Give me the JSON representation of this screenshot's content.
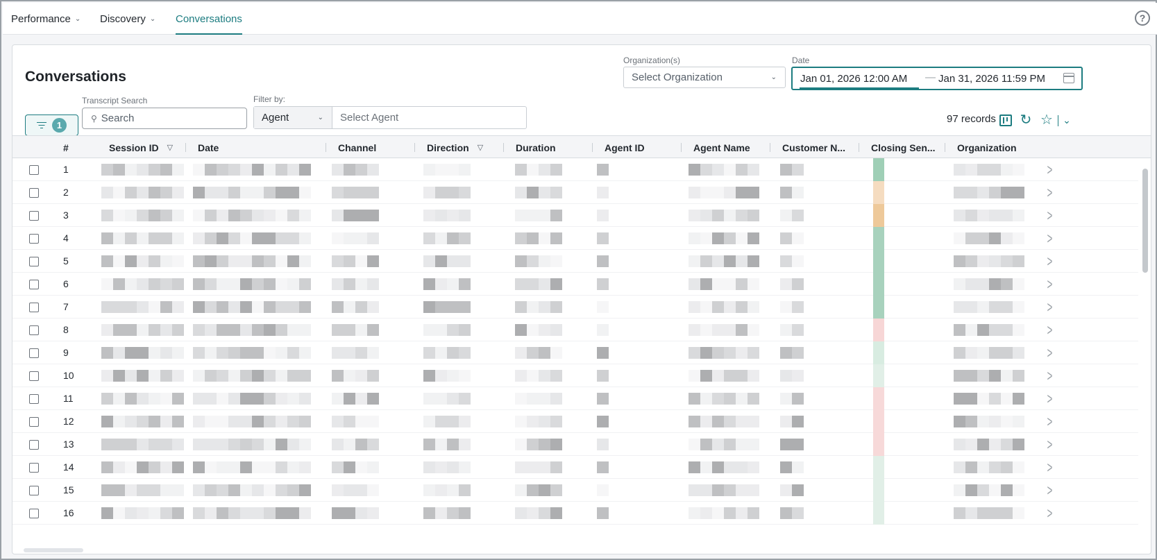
{
  "nav": {
    "items": [
      {
        "label": "Performance",
        "has_menu": true,
        "active": false
      },
      {
        "label": "Discovery",
        "has_menu": true,
        "active": false
      },
      {
        "label": "Conversations",
        "has_menu": false,
        "active": true
      }
    ],
    "help_icon": "?"
  },
  "page": {
    "title": "Conversations"
  },
  "organization": {
    "label": "Organization(s)",
    "placeholder": "Select Organization"
  },
  "date": {
    "label": "Date",
    "start": "Jan 01, 2026 12:00 AM",
    "separator": "—",
    "end": "Jan 31, 2026 11:59 PM"
  },
  "filters": {
    "active_count": "1",
    "transcript_search_label": "Transcript Search",
    "search_placeholder": "Search",
    "filter_by_label": "Filter by:",
    "filter_by_value": "Agent",
    "agent_placeholder": "Select Agent"
  },
  "toolbar": {
    "records": "97 records",
    "icons": [
      "board-icon",
      "refresh-icon",
      "star-icon",
      "chevron-down-icon"
    ]
  },
  "table": {
    "columns": [
      "#",
      "Session ID",
      "Date",
      "Channel",
      "Direction",
      "Duration",
      "Agent ID",
      "Agent Name",
      "Customer N...",
      "Closing Sen...",
      "Organization"
    ],
    "filterable_columns": [
      "Session ID",
      "Direction"
    ],
    "row_numbers": [
      "1",
      "2",
      "3",
      "4",
      "5",
      "6",
      "7",
      "8",
      "9",
      "10",
      "11",
      "12",
      "13",
      "14",
      "15",
      "16"
    ],
    "closing_sentiment_colors": [
      "#9fcfb6",
      "#f5dcc0",
      "#eec99a",
      "#a8d2bd",
      "#a8d2bd",
      "#a8d2bd",
      "#a8d2bd",
      "#f7d6d6",
      "#d8ece1",
      "#e1efe7",
      "#f7d9d9",
      "#f7d9d9",
      "#f7d9d9",
      "#e1efe7",
      "#e1efe7",
      "#e1efe7"
    ]
  },
  "colors": {
    "accent": "#1c7c80",
    "header_bg": "#f4f5f7",
    "page_bg": "#f4f5f7"
  }
}
